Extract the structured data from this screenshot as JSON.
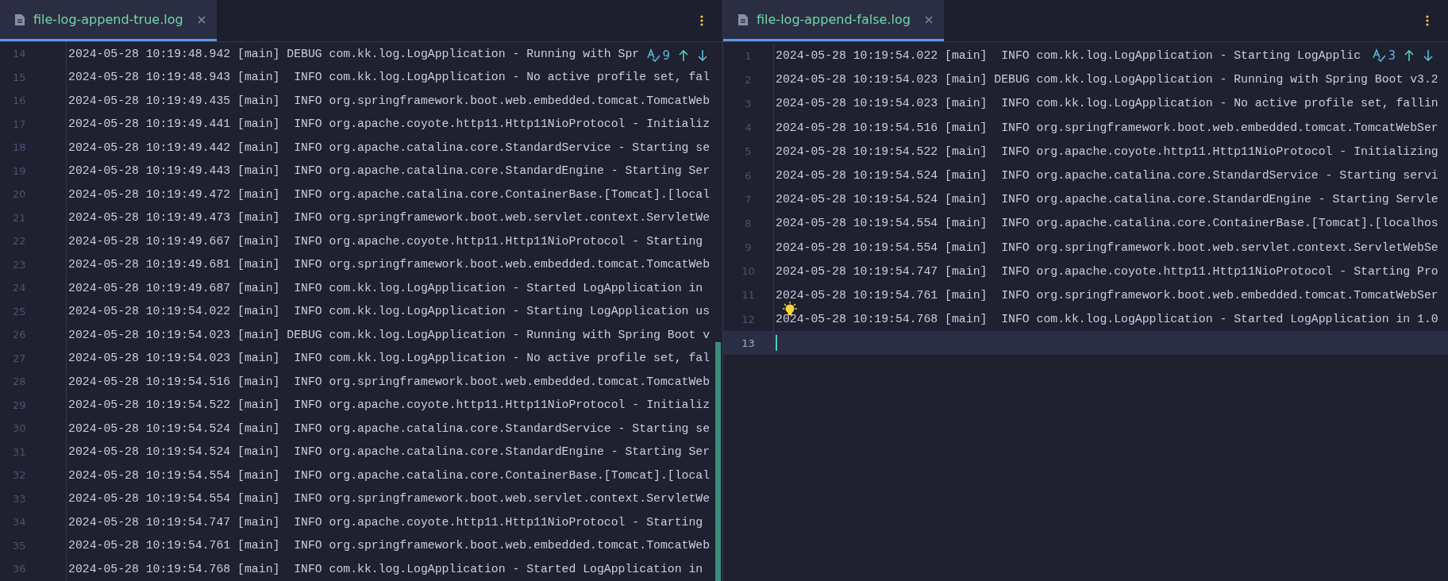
{
  "panes": [
    {
      "tab": {
        "title": "file-log-append-true.log",
        "selected": true
      },
      "find": {
        "count": "9"
      },
      "lines": [
        {
          "number": "14",
          "text": "2024-05-28 10:19:48.942 [main] DEBUG com.kk.log.LogApplication - Running with Spr",
          "current": false
        },
        {
          "number": "15",
          "text": "2024-05-28 10:19:48.943 [main]  INFO com.kk.log.LogApplication - No active profile set, fal",
          "current": false
        },
        {
          "number": "16",
          "text": "2024-05-28 10:19:49.435 [main]  INFO org.springframework.boot.web.embedded.tomcat.TomcatWeb",
          "current": false
        },
        {
          "number": "17",
          "text": "2024-05-28 10:19:49.441 [main]  INFO org.apache.coyote.http11.Http11NioProtocol - Initializ",
          "current": false
        },
        {
          "number": "18",
          "text": "2024-05-28 10:19:49.442 [main]  INFO org.apache.catalina.core.StandardService - Starting se",
          "current": false
        },
        {
          "number": "19",
          "text": "2024-05-28 10:19:49.443 [main]  INFO org.apache.catalina.core.StandardEngine - Starting Ser",
          "current": false
        },
        {
          "number": "20",
          "text": "2024-05-28 10:19:49.472 [main]  INFO org.apache.catalina.core.ContainerBase.[Tomcat].[local",
          "current": false
        },
        {
          "number": "21",
          "text": "2024-05-28 10:19:49.473 [main]  INFO org.springframework.boot.web.servlet.context.ServletWe",
          "current": false
        },
        {
          "number": "22",
          "text": "2024-05-28 10:19:49.667 [main]  INFO org.apache.coyote.http11.Http11NioProtocol - Starting",
          "current": false
        },
        {
          "number": "23",
          "text": "2024-05-28 10:19:49.681 [main]  INFO org.springframework.boot.web.embedded.tomcat.TomcatWeb",
          "current": false
        },
        {
          "number": "24",
          "text": "2024-05-28 10:19:49.687 [main]  INFO com.kk.log.LogApplication - Started LogApplication in",
          "current": false
        },
        {
          "number": "25",
          "text": "2024-05-28 10:19:54.022 [main]  INFO com.kk.log.LogApplication - Starting LogApplication us",
          "current": false
        },
        {
          "number": "26",
          "text": "2024-05-28 10:19:54.023 [main] DEBUG com.kk.log.LogApplication - Running with Spring Boot v",
          "current": false
        },
        {
          "number": "27",
          "text": "2024-05-28 10:19:54.023 [main]  INFO com.kk.log.LogApplication - No active profile set, fal",
          "current": false
        },
        {
          "number": "28",
          "text": "2024-05-28 10:19:54.516 [main]  INFO org.springframework.boot.web.embedded.tomcat.TomcatWeb",
          "current": false
        },
        {
          "number": "29",
          "text": "2024-05-28 10:19:54.522 [main]  INFO org.apache.coyote.http11.Http11NioProtocol - Initializ",
          "current": false
        },
        {
          "number": "30",
          "text": "2024-05-28 10:19:54.524 [main]  INFO org.apache.catalina.core.StandardService - Starting se",
          "current": false
        },
        {
          "number": "31",
          "text": "2024-05-28 10:19:54.524 [main]  INFO org.apache.catalina.core.StandardEngine - Starting Ser",
          "current": false
        },
        {
          "number": "32",
          "text": "2024-05-28 10:19:54.554 [main]  INFO org.apache.catalina.core.ContainerBase.[Tomcat].[local",
          "current": false
        },
        {
          "number": "33",
          "text": "2024-05-28 10:19:54.554 [main]  INFO org.springframework.boot.web.servlet.context.ServletWe",
          "current": false
        },
        {
          "number": "34",
          "text": "2024-05-28 10:19:54.747 [main]  INFO org.apache.coyote.http11.Http11NioProtocol - Starting",
          "current": false
        },
        {
          "number": "35",
          "text": "2024-05-28 10:19:54.761 [main]  INFO org.springframework.boot.web.embedded.tomcat.TomcatWeb",
          "current": false
        },
        {
          "number": "36",
          "text": "2024-05-28 10:19:54.768 [main]  INFO com.kk.log.LogApplication - Started LogApplication in",
          "current": false
        }
      ]
    },
    {
      "tab": {
        "title": "file-log-append-false.log",
        "selected": true
      },
      "find": {
        "count": "3"
      },
      "lines": [
        {
          "number": "1",
          "text": "2024-05-28 10:19:54.022 [main]  INFO com.kk.log.LogApplication - Starting LogApplic",
          "current": false
        },
        {
          "number": "2",
          "text": "2024-05-28 10:19:54.023 [main] DEBUG com.kk.log.LogApplication - Running with Spring Boot v3.2",
          "current": false
        },
        {
          "number": "3",
          "text": "2024-05-28 10:19:54.023 [main]  INFO com.kk.log.LogApplication - No active profile set, fallin",
          "current": false
        },
        {
          "number": "4",
          "text": "2024-05-28 10:19:54.516 [main]  INFO org.springframework.boot.web.embedded.tomcat.TomcatWebSer",
          "current": false
        },
        {
          "number": "5",
          "text": "2024-05-28 10:19:54.522 [main]  INFO org.apache.coyote.http11.Http11NioProtocol - Initializing",
          "current": false
        },
        {
          "number": "6",
          "text": "2024-05-28 10:19:54.524 [main]  INFO org.apache.catalina.core.StandardService - Starting servi",
          "current": false
        },
        {
          "number": "7",
          "text": "2024-05-28 10:19:54.524 [main]  INFO org.apache.catalina.core.StandardEngine - Starting Servle",
          "current": false
        },
        {
          "number": "8",
          "text": "2024-05-28 10:19:54.554 [main]  INFO org.apache.catalina.core.ContainerBase.[Tomcat].[localhos",
          "current": false
        },
        {
          "number": "9",
          "text": "2024-05-28 10:19:54.554 [main]  INFO org.springframework.boot.web.servlet.context.ServletWebSe",
          "current": false
        },
        {
          "number": "10",
          "text": "2024-05-28 10:19:54.747 [main]  INFO org.apache.coyote.http11.Http11NioProtocol - Starting Pro",
          "current": false
        },
        {
          "number": "11",
          "text": "2024-05-28 10:19:54.761 [main]  INFO org.springframework.boot.web.embedded.tomcat.TomcatWebSer",
          "current": false
        },
        {
          "number": "12",
          "text": "2024-05-28 10:19:54.768 [main]  INFO com.kk.log.LogApplication - Started LogApplication in 1.0",
          "current": false
        },
        {
          "number": "13",
          "current": true
        }
      ]
    }
  ]
}
